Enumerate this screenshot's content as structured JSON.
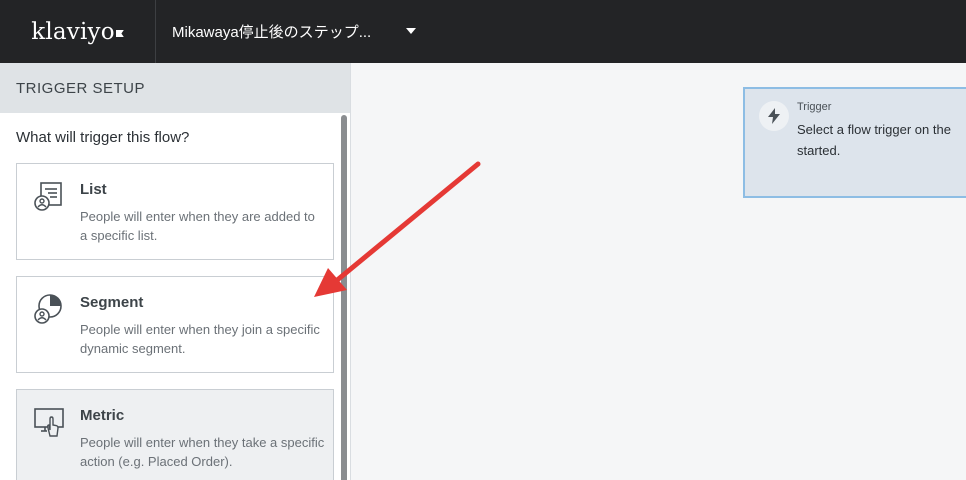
{
  "header": {
    "logo_text": "klaviyo",
    "flow_name": "Mikawaya停止後のステップ..."
  },
  "panel": {
    "title": "TRIGGER SETUP",
    "question": "What will trigger this flow?",
    "options": [
      {
        "icon": "list-icon",
        "title": "List",
        "description": "People will enter when they are added to a specific list."
      },
      {
        "icon": "segment-icon",
        "title": "Segment",
        "description": "People will enter when they join a specific dynamic segment."
      },
      {
        "icon": "metric-icon",
        "title": "Metric",
        "description": "People will enter when they take a specific action (e.g. Placed Order)."
      }
    ]
  },
  "canvas": {
    "trigger_node": {
      "icon": "lightning-icon",
      "label": "Trigger",
      "text": "Select a flow trigger on the started."
    }
  },
  "annotation": {
    "arrow_color": "#e53935"
  },
  "colors": {
    "topbar": "#232426",
    "node_border": "#8dbde4",
    "node_bg": "#dde4ec"
  }
}
